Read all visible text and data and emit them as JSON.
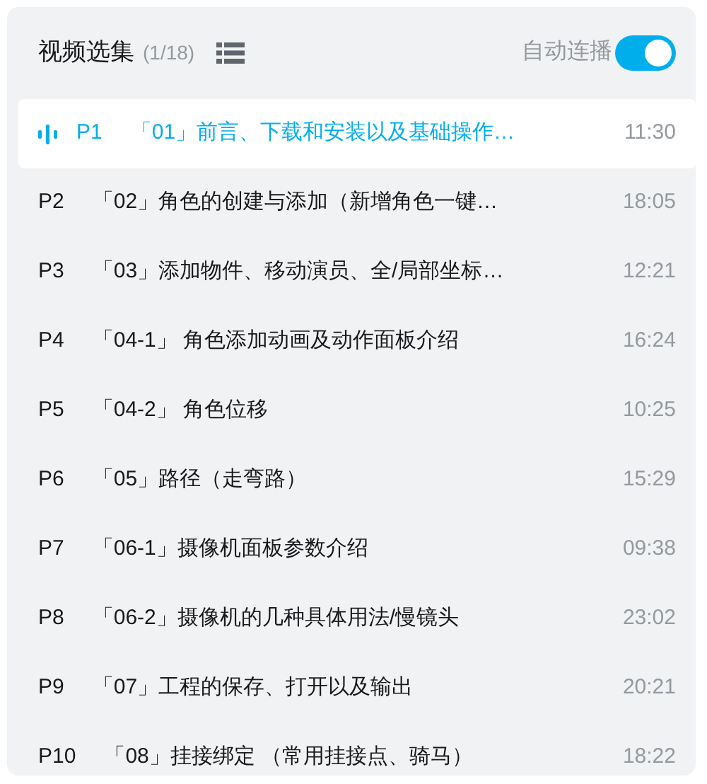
{
  "header": {
    "title": "视频选集",
    "count": "(1/18)",
    "autoplay": {
      "label": "自动连播",
      "on": true
    }
  },
  "episodes": [
    {
      "number": "P1",
      "title": "「01」前言、下载和安装以及基础操作…",
      "duration": "11:30",
      "selected": true
    },
    {
      "number": "P2",
      "title": "「02」角色的创建与添加（新增角色一键…",
      "duration": "18:05",
      "selected": false
    },
    {
      "number": "P3",
      "title": "「03」添加物件、移动演员、全/局部坐标…",
      "duration": "12:21",
      "selected": false
    },
    {
      "number": "P4",
      "title": "「04-1」 角色添加动画及动作面板介绍",
      "duration": "16:24",
      "selected": false
    },
    {
      "number": "P5",
      "title": "「04-2」 角色位移",
      "duration": "10:25",
      "selected": false
    },
    {
      "number": "P6",
      "title": "「05」路径（走弯路）",
      "duration": "15:29",
      "selected": false
    },
    {
      "number": "P7",
      "title": "「06-1」摄像机面板参数介绍",
      "duration": "09:38",
      "selected": false
    },
    {
      "number": "P8",
      "title": "「06-2」摄像机的几种具体用法/慢镜头",
      "duration": "23:02",
      "selected": false
    },
    {
      "number": "P9",
      "title": "「07」工程的保存、打开以及输出",
      "duration": "20:21",
      "selected": false
    },
    {
      "number": "P10",
      "title": "「08」挂接绑定 （常用挂接点、骑马）",
      "duration": "18:22",
      "selected": false
    }
  ]
}
